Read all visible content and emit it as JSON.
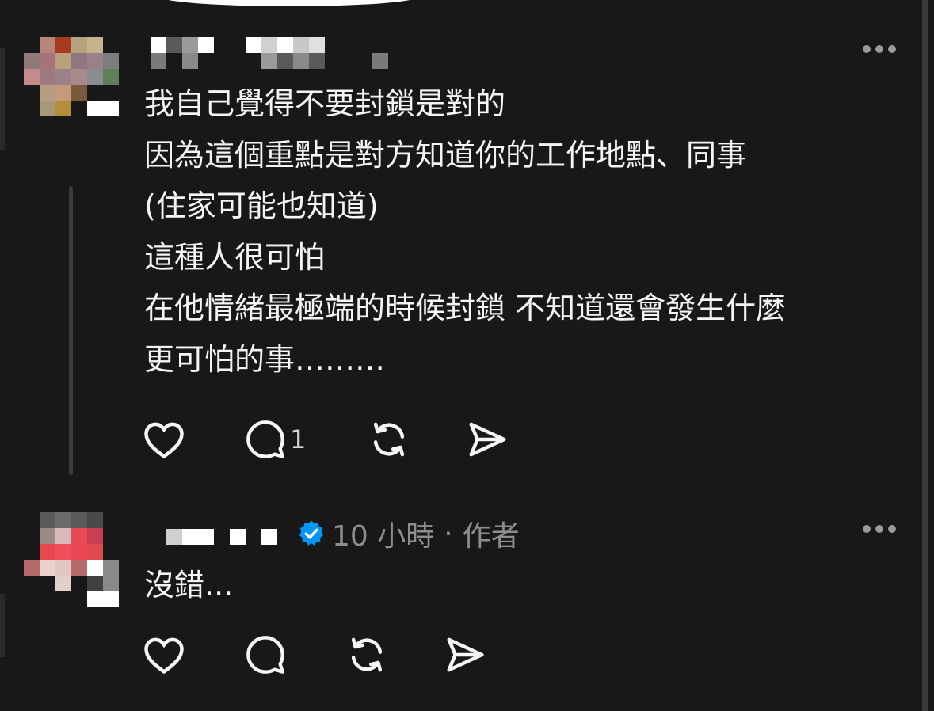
{
  "post": {
    "text": "我自己覺得不要封鎖是對的\n因為這個重點是對方知道你的工作地點、同事\n(住家可能也知道)\n這種人很可怕\n在他情緒最極端的時候封鎖 不知道還會發生什麼\n更可怕的事………",
    "more_icon": "more-horizontal-icon",
    "actions": {
      "reply_count": "1"
    }
  },
  "reply": {
    "timestamp": "10 小時",
    "separator": "·",
    "author_badge": "作者",
    "text": "沒錯...",
    "more_icon": "more-horizontal-icon"
  },
  "colors": {
    "background": "#181818",
    "text": "#f3f5f7",
    "muted": "#8e8e8e",
    "verified": "#0095f6"
  }
}
